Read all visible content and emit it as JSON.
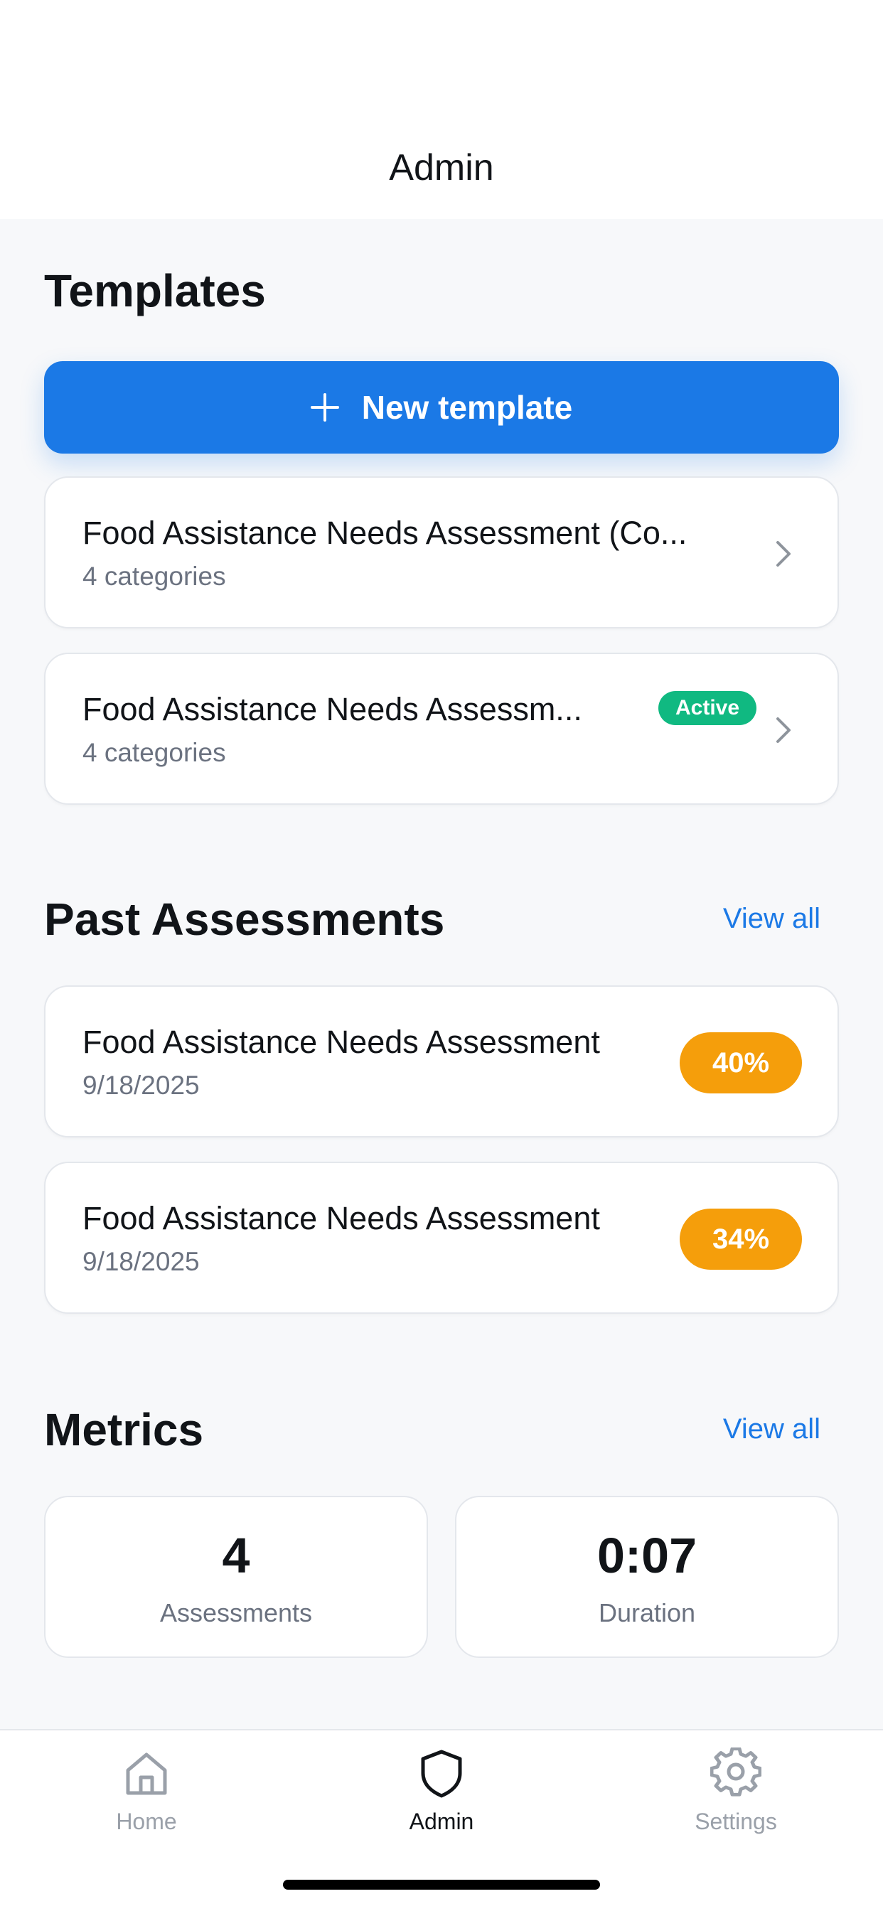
{
  "header": {
    "title": "Admin"
  },
  "templates": {
    "title": "Templates",
    "new_button_label": "New template",
    "items": [
      {
        "title": "Food Assistance Needs Assessment (Co...",
        "subtitle": "4 categories"
      },
      {
        "title": "Food Assistance Needs Assessm...",
        "subtitle": "4 categories",
        "badge": "Active"
      }
    ]
  },
  "past_assessments": {
    "title": "Past Assessments",
    "view_all": "View all",
    "items": [
      {
        "title": "Food Assistance Needs Assessment",
        "date": "9/18/2025",
        "score": "40%"
      },
      {
        "title": "Food Assistance Needs Assessment",
        "date": "9/18/2025",
        "score": "34%"
      }
    ]
  },
  "metrics": {
    "title": "Metrics",
    "view_all": "View all",
    "items": [
      {
        "value": "4",
        "label": "Assessments"
      },
      {
        "value": "0:07",
        "label": "Duration"
      }
    ]
  },
  "tabbar": {
    "tabs": [
      {
        "label": "Home",
        "icon": "home-icon",
        "active": false
      },
      {
        "label": "Admin",
        "icon": "shield-icon",
        "active": true
      },
      {
        "label": "Settings",
        "icon": "gear-icon",
        "active": false
      }
    ]
  },
  "colors": {
    "primary": "#1b79e6",
    "active_badge": "#10b981",
    "score_badge": "#f59e0b",
    "background": "#f7f8fa"
  }
}
